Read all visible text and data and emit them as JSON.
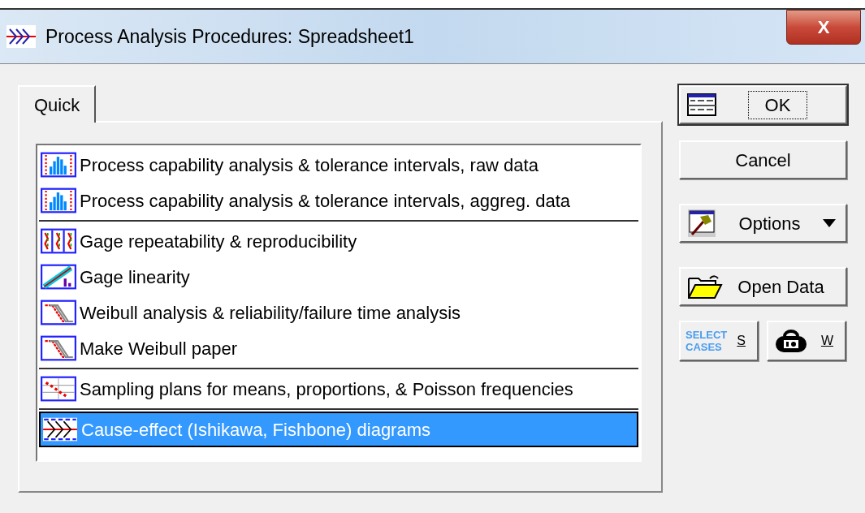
{
  "window": {
    "title": "Process Analysis Procedures: Spreadsheet1",
    "close": "X"
  },
  "tabs": [
    {
      "label": "Quick",
      "selected": true
    }
  ],
  "list": {
    "groups": [
      {
        "items": [
          {
            "label": "Process capability analysis & tolerance intervals, raw data",
            "kind": "capability",
            "selected": false
          },
          {
            "label": "Process capability analysis & tolerance intervals, aggreg. data",
            "kind": "capability",
            "selected": false
          }
        ]
      },
      {
        "items": [
          {
            "label": "Gage repeatability & reproducibility",
            "kind": "gage",
            "selected": false
          },
          {
            "label": "Gage linearity",
            "kind": "linearity",
            "selected": false
          },
          {
            "label": "Weibull analysis & reliability/failure time analysis",
            "kind": "weibull",
            "selected": false
          },
          {
            "label": "Make Weibull paper",
            "kind": "weibull",
            "selected": false
          }
        ]
      },
      {
        "items": [
          {
            "label": "Sampling plans for means, proportions, & Poisson frequencies",
            "kind": "sampling",
            "selected": false
          }
        ]
      },
      {
        "items": [
          {
            "label": "Cause-effect (Ishikawa, Fishbone) diagrams",
            "kind": "fishbone",
            "selected": true
          }
        ]
      }
    ]
  },
  "buttons": [
    {
      "label": "OK",
      "kind": "ok"
    },
    {
      "label": "Cancel",
      "kind": "plain"
    },
    {
      "label": "Options",
      "kind": "options"
    },
    {
      "label": "Open Data",
      "kind": "open"
    }
  ],
  "small_buttons": [
    {
      "label": "S",
      "icon_text": "SELECT CASES",
      "kind": "select"
    },
    {
      "label": "W",
      "kind": "weight"
    }
  ]
}
